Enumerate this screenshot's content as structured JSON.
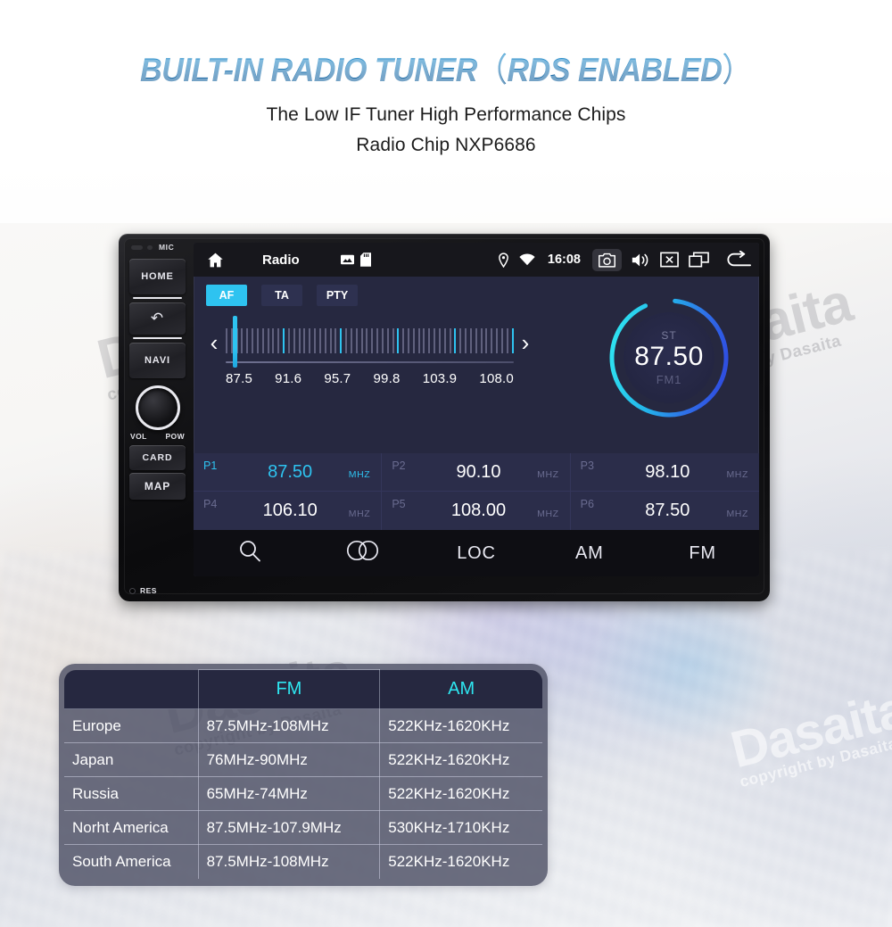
{
  "header": {
    "title_main": "BUILT-IN RADIO TUNER",
    "title_paren_open": "（",
    "title_paren_text": "RDS ENABLED",
    "title_paren_close": "）",
    "subtitle_1": "The Low IF Tuner High Performance Chips",
    "subtitle_2": "Radio Chip  NXP6686"
  },
  "watermark": {
    "brand": "Dasaita",
    "copyright": "copyright by Dasaita"
  },
  "head_unit": {
    "mic_label": "MIC",
    "buttons": [
      {
        "label": "HOME",
        "name": "home-hardware-button"
      },
      {
        "label": "↶",
        "name": "back-hardware-button"
      },
      {
        "label": "NAVI",
        "name": "navi-hardware-button"
      },
      {
        "label": "CARD",
        "name": "card-hardware-button"
      },
      {
        "label": "MAP",
        "name": "map-hardware-button"
      }
    ],
    "knob_left_label": "VOL",
    "knob_right_label": "POW",
    "reset_label": "RES"
  },
  "screen": {
    "status_bar": {
      "title": "Radio",
      "clock": "16:08",
      "icons_left": [
        "home-icon",
        "gallery-icon",
        "sd-card-icon"
      ],
      "icons_status": [
        "location-pin-icon",
        "wifi-icon"
      ],
      "icons_right": [
        "camera-icon",
        "volume-icon",
        "close-box-icon",
        "recents-icon",
        "back-arrow-icon"
      ]
    },
    "rds_buttons": [
      {
        "label": "AF",
        "active": true
      },
      {
        "label": "TA",
        "active": false
      },
      {
        "label": "PTY",
        "active": false
      }
    ],
    "tuner": {
      "prev_arrow": "‹",
      "next_arrow": "›",
      "scale_labels": [
        "87.5",
        "91.6",
        "95.7",
        "99.8",
        "103.9",
        "108.0"
      ],
      "cursor_position_percent": 2
    },
    "dial": {
      "stereo_label": "ST",
      "frequency": "87.50",
      "band": "FM1",
      "ring_color_start": "#2ee0f0",
      "ring_color_end": "#2f4fe0"
    },
    "presets": [
      {
        "slot": "P1",
        "freq": "87.50",
        "unit": "MHZ",
        "active": true
      },
      {
        "slot": "P2",
        "freq": "90.10",
        "unit": "MHZ",
        "active": false
      },
      {
        "slot": "P3",
        "freq": "98.10",
        "unit": "MHZ",
        "active": false
      },
      {
        "slot": "P4",
        "freq": "106.10",
        "unit": "MHZ",
        "active": false
      },
      {
        "slot": "P5",
        "freq": "108.00",
        "unit": "MHZ",
        "active": false
      },
      {
        "slot": "P6",
        "freq": "87.50",
        "unit": "MHZ",
        "active": false
      }
    ],
    "toolbar": [
      {
        "label": "",
        "icon": "search-icon"
      },
      {
        "label": "",
        "icon": "stereo-icon"
      },
      {
        "label": "LOC",
        "icon": ""
      },
      {
        "label": "AM",
        "icon": ""
      },
      {
        "label": "FM",
        "icon": ""
      }
    ]
  },
  "band_table": {
    "columns": [
      "",
      "FM",
      "AM"
    ],
    "rows": [
      {
        "region": "Europe",
        "fm": "87.5MHz-108MHz",
        "am": "522KHz-1620KHz"
      },
      {
        "region": "Japan",
        "fm": "76MHz-90MHz",
        "am": "522KHz-1620KHz"
      },
      {
        "region": "Russia",
        "fm": "65MHz-74MHz",
        "am": "522KHz-1620KHz"
      },
      {
        "region": "Norht America",
        "fm": "87.5MHz-107.9MHz",
        "am": "530KHz-1710KHz"
      },
      {
        "region": "South America",
        "fm": "87.5MHz-108MHz",
        "am": "522KHz-1620KHz"
      }
    ]
  }
}
